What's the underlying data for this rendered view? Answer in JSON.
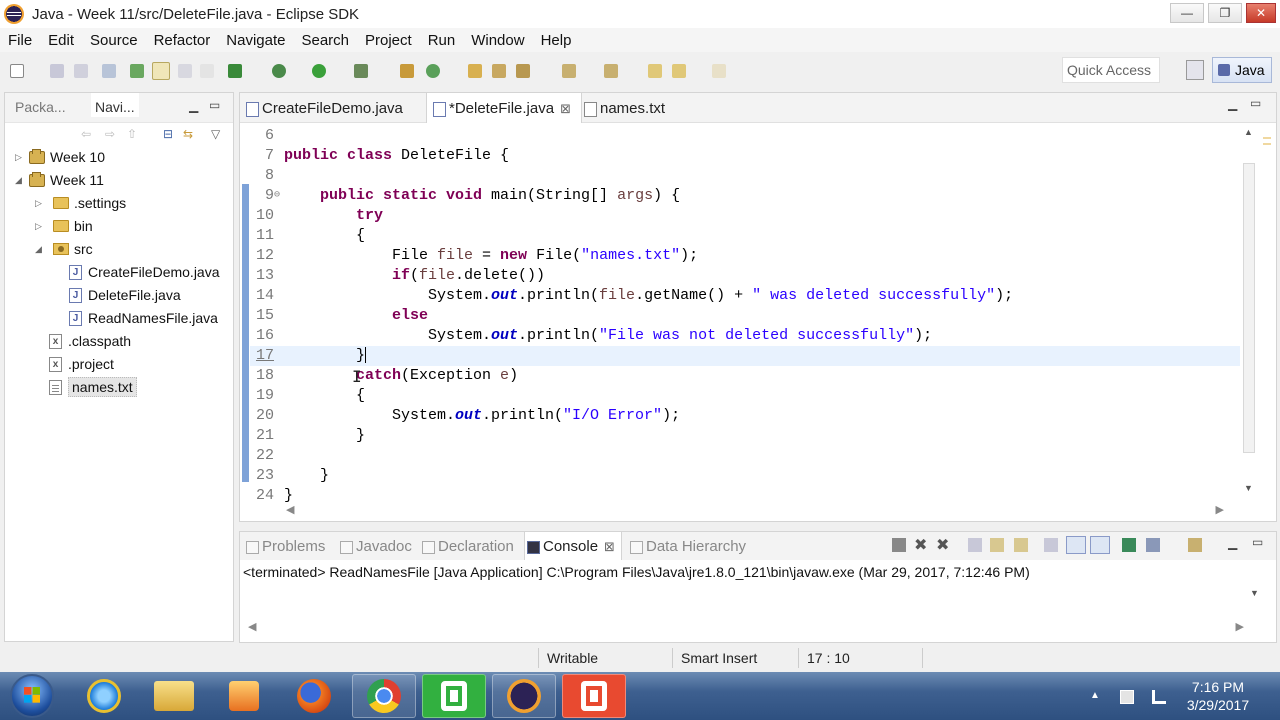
{
  "window": {
    "title": "Java - Week 11/src/DeleteFile.java - Eclipse SDK"
  },
  "window_buttons": {
    "minimize": "—",
    "restore": "❐",
    "close": "✕"
  },
  "menu": [
    "File",
    "Edit",
    "Source",
    "Refactor",
    "Navigate",
    "Search",
    "Project",
    "Run",
    "Window",
    "Help"
  ],
  "toolbar": {
    "quick_access": "Quick Access",
    "perspective": "Java"
  },
  "left_panel": {
    "tabs": [
      "Packa...",
      "Navi..."
    ],
    "tree": [
      {
        "label": "Week 10",
        "kind": "project",
        "expanded": false
      },
      {
        "label": "Week 11",
        "kind": "project",
        "expanded": true
      },
      {
        "label": ".settings",
        "kind": "folder",
        "expanded": false
      },
      {
        "label": "bin",
        "kind": "folder",
        "expanded": false
      },
      {
        "label": "src",
        "kind": "folder",
        "expanded": true
      },
      {
        "label": "CreateFileDemo.java",
        "kind": "java"
      },
      {
        "label": "DeleteFile.java",
        "kind": "java"
      },
      {
        "label": "ReadNamesFile.java",
        "kind": "java"
      },
      {
        "label": ".classpath",
        "kind": "xml"
      },
      {
        "label": ".project",
        "kind": "xml"
      },
      {
        "label": "names.txt",
        "kind": "txt",
        "selected": true
      }
    ]
  },
  "editor": {
    "tabs": [
      {
        "label": "CreateFileDemo.java",
        "active": false
      },
      {
        "label": "*DeleteFile.java",
        "active": true
      },
      {
        "label": "names.txt",
        "active": false
      }
    ],
    "line_numbers": [
      "6",
      "7",
      "8",
      "9",
      "10",
      "11",
      "12",
      "13",
      "14",
      "15",
      "16",
      "17",
      "18",
      "19",
      "20",
      "21",
      "22",
      "23",
      "24"
    ],
    "code": {
      "l7_kw": "public class",
      "l7_rest": " DeleteFile {",
      "l9_kw": "public static void",
      "l9_rest1": " main(String[] ",
      "l9_var": "args",
      "l9_rest2": ") {",
      "l10_kw": "try",
      "l11": "{",
      "l12_a": "File ",
      "l12_var": "file",
      "l12_b": " = ",
      "l12_kw": "new",
      "l12_c": " File(",
      "l12_str": "\"names.txt\"",
      "l12_d": ");",
      "l13_kw": "if",
      "l13_a": "(",
      "l13_var": "file",
      "l13_b": ".delete())",
      "l14_a": "System.",
      "l14_fld": "out",
      "l14_b": ".println(",
      "l14_var": "file",
      "l14_c": ".getName() + ",
      "l14_str": "\" was deleted successfully\"",
      "l14_d": ");",
      "l15_kw": "else",
      "l16_a": "System.",
      "l16_fld": "out",
      "l16_b": ".println(",
      "l16_str": "\"File was not deleted successfully\"",
      "l16_d": ");",
      "l17": "}",
      "l18_kw": "catch",
      "l18_a": "(Exception ",
      "l18_var": "e",
      "l18_b": ")",
      "l19": "{",
      "l20_a": "System.",
      "l20_fld": "out",
      "l20_b": ".println(",
      "l20_str": "\"I/O Error\"",
      "l20_d": ");",
      "l21": "}",
      "l23": "}",
      "l24": "}"
    }
  },
  "console": {
    "tabs": [
      "Problems",
      "Javadoc",
      "Declaration",
      "Console",
      "Data Hierarchy"
    ],
    "active_tab": "Console",
    "message": "<terminated> ReadNamesFile [Java Application] C:\\Program Files\\Java\\jre1.8.0_121\\bin\\javaw.exe (Mar 29, 2017, 7:12:46 PM)"
  },
  "status": {
    "mode": "Writable",
    "insert": "Smart Insert",
    "position": "17 : 10"
  },
  "taskbar": {
    "time": "7:16 PM",
    "date": "3/29/2017"
  },
  "colors": {
    "keyword": "#7f0055",
    "string": "#2a00ff",
    "local_var": "#6a3e3e",
    "field": "#0000c0",
    "current_line": "#e8f2fe",
    "taskbar": "#3e6090"
  }
}
